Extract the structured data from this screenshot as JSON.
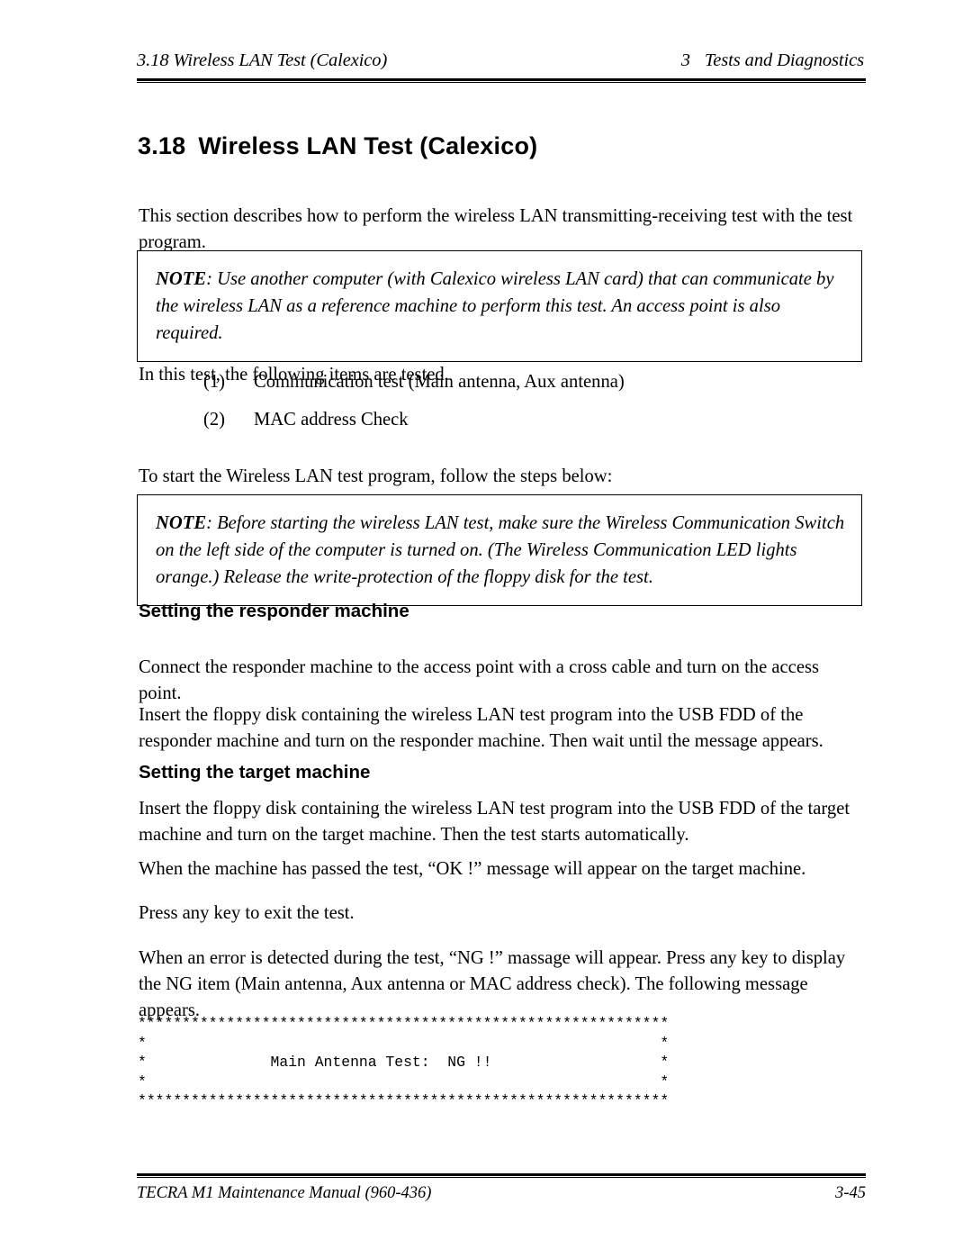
{
  "header": {
    "left": "3.18  Wireless LAN Test  (Calexico)",
    "right_num": "3",
    "right_text": "Tests and Diagnostics"
  },
  "section": {
    "number": "3.18",
    "title": "Wireless LAN Test  (Calexico)"
  },
  "intro_paragraph": "This section describes how to perform the wireless LAN transmitting-receiving test with the test program.",
  "note1": {
    "label": "NOTE",
    "text": ": Use another computer (with Calexico wireless LAN card) that can communicate by the wireless LAN as a reference machine to perform this test. An access point is also required."
  },
  "items_intro": "In this test, the following items are tested.",
  "test_items": [
    {
      "marker": "(1)",
      "label": "Communication test (Main antenna, Aux antenna)"
    },
    {
      "marker": "(2)",
      "label": "MAC address Check"
    }
  ],
  "start_paragraph": "To start the Wireless LAN test program, follow the steps below:",
  "note2": {
    "label": "NOTE",
    "text": ": Before starting the wireless LAN test, make sure the Wireless Communication Switch on the left side of the computer is turned on. (The Wireless Communication LED lights orange.) Release the write-protection of the floppy disk for the test."
  },
  "responder": {
    "heading": "Setting the responder machine",
    "paragraph1": "Connect the responder machine to the access point with a cross cable and turn on the access point.",
    "paragraph2": "Insert the floppy disk containing the wireless LAN test program into the USB FDD of the responder machine and turn on the responder machine. Then wait until the message appears."
  },
  "target": {
    "heading": "Setting the target machine",
    "paragraph1": "Insert the floppy disk containing the wireless LAN test program into the USB FDD of the target machine and turn on the target machine. Then the test starts automatically.",
    "paragraph2": "When the machine has passed the test, “OK !” message will appear on the target machine.",
    "paragraph3": "Press any key to exit the test.",
    "paragraph4": "When an error is detected during the test, “NG !” massage will appear. Press any key to display the NG item (Main antenna, Aux antenna or MAC address check). The following message appears."
  },
  "ascii_output": "************************************************************\n*                                                          *\n*              Main Antenna Test:  NG !!                   *\n*                                                          *\n************************************************************",
  "footer": {
    "left": "TECRA M1 Maintenance Manual (960-436)",
    "right": "3-45"
  }
}
